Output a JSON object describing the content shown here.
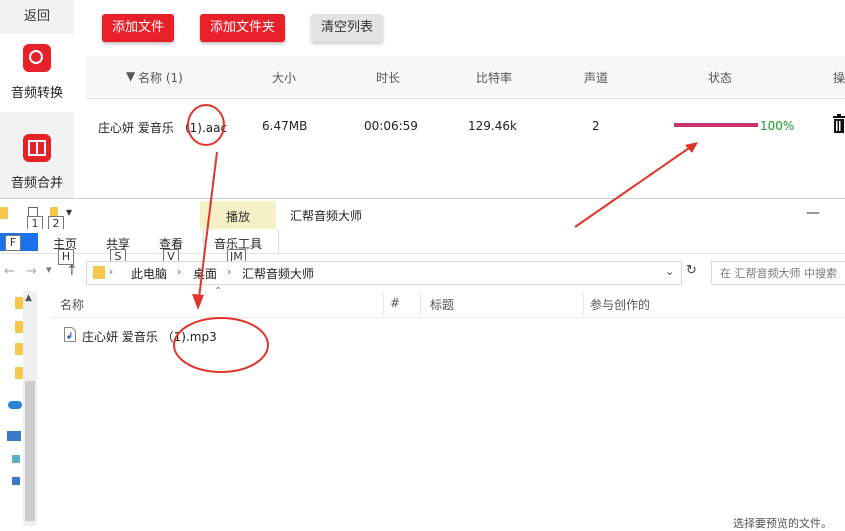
{
  "app": {
    "back_label": "返回",
    "sidebar": [
      {
        "label": "音频转换"
      },
      {
        "label": "音频合并"
      }
    ],
    "toolbar": {
      "add_file": "添加文件",
      "add_folder": "添加文件夹",
      "clear_list": "清空列表"
    },
    "table": {
      "headers": {
        "name": "名称 (1)",
        "size": "大小",
        "duration": "时长",
        "bitrate": "比特率",
        "channels": "声道",
        "status": "状态",
        "action": "操"
      },
      "rows": [
        {
          "name": "庄心妍 爱音乐 （1).aac",
          "size": "6.47MB",
          "duration": "00:06:59",
          "bitrate": "129.46k",
          "channels": "2",
          "progress": 100,
          "progress_label": "100%"
        }
      ]
    },
    "colors": {
      "accent": "#e8202a",
      "progress": "#c8326e",
      "progress_text": "#1a9a2a"
    }
  },
  "explorer": {
    "title": "汇帮音频大师",
    "context_tab": "播放",
    "ribbon_tabs": [
      "主页",
      "共享",
      "查看",
      "音乐工具"
    ],
    "keytips": {
      "qat1": "1",
      "qat2": "2",
      "file": "F",
      "home": "H",
      "share": "S",
      "view": "V",
      "music_tools": "JM"
    },
    "breadcrumb": [
      "此电脑",
      "桌面",
      "汇帮音频大师"
    ],
    "search_placeholder": "在 汇帮音频大师 中搜索",
    "columns": [
      "名称",
      "#",
      "标题",
      "参与创作的"
    ],
    "files": [
      {
        "name": "庄心妍 爱音乐 （1).mp3"
      }
    ],
    "preview_hint": "选择要预览的文件。"
  }
}
